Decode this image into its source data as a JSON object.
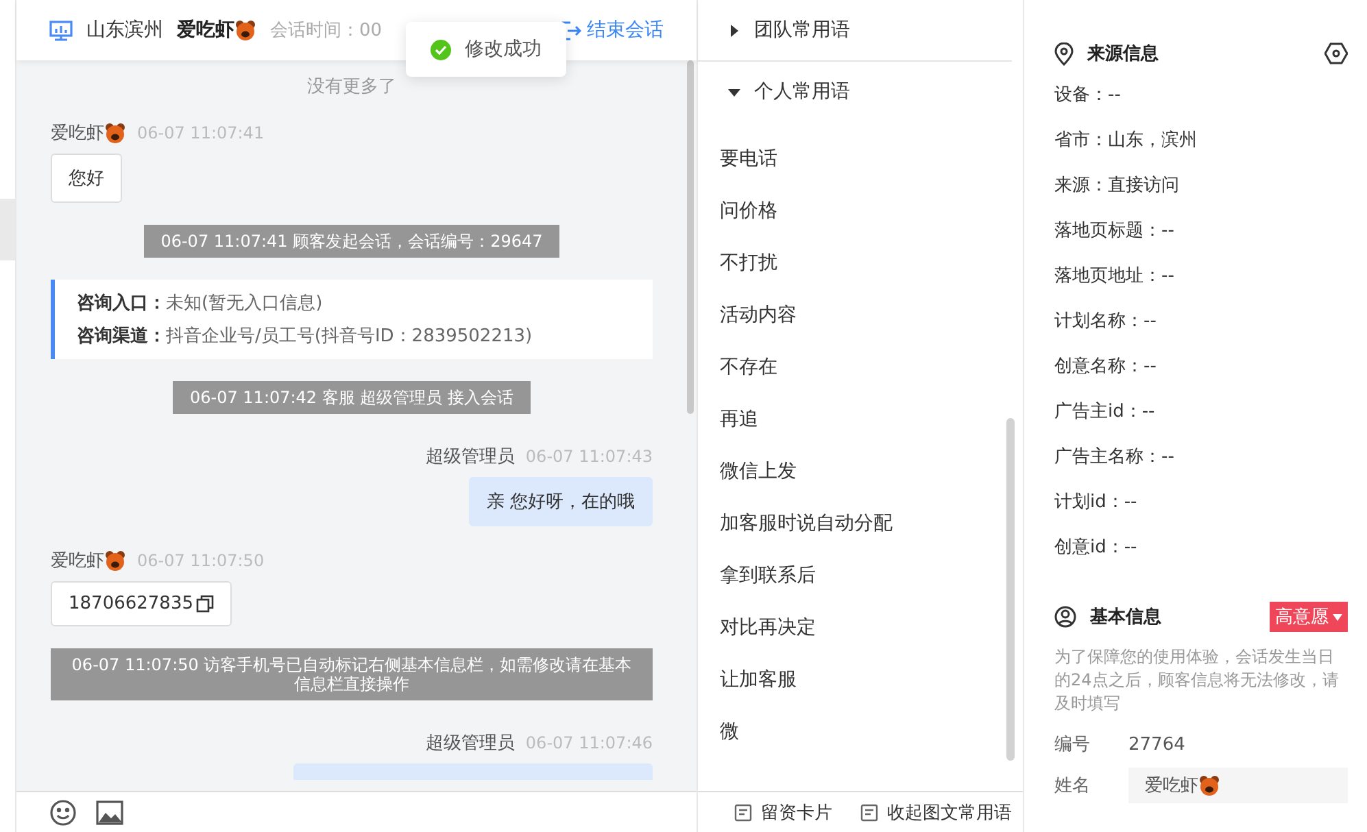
{
  "header": {
    "location": "山东滨州",
    "visitor": "爱吃虾",
    "session_time": "会话时间：00",
    "end_button": "结束会话"
  },
  "toast": {
    "text": "修改成功"
  },
  "messages": [
    {
      "kind": "notice",
      "text": "没有更多了"
    },
    {
      "kind": "visitor",
      "name": "爱吃虾",
      "time": "06-07 11:07:41",
      "text": "您好",
      "copyable": false
    },
    {
      "kind": "system",
      "text": "06-07 11:07:41 顾客发起会话，会话编号：29647"
    },
    {
      "kind": "info",
      "rows": [
        {
          "label": "咨询入口：",
          "value": "未知(暂无入口信息)"
        },
        {
          "label": "咨询渠道：",
          "value": "抖音企业号/员工号(抖音号ID：2839502213)"
        }
      ]
    },
    {
      "kind": "system",
      "text": "06-07 11:07:42 客服 超级管理员 接入会话"
    },
    {
      "kind": "agent",
      "name": "超级管理员",
      "time": "06-07 11:07:43",
      "text": "亲 您好呀，在的哦"
    },
    {
      "kind": "visitor",
      "name": "爱吃虾",
      "time": "06-07 11:07:50",
      "text": "18706627835",
      "copyable": true
    },
    {
      "kind": "system",
      "text": "06-07 11:07:50 访客手机号已自动标记右侧基本信息栏，如需修改请在基本信息栏直接操作"
    },
    {
      "kind": "agent",
      "name": "超级管理员",
      "time": "06-07 11:07:46"
    }
  ],
  "phrases": {
    "groups": [
      {
        "title": "团队常用语",
        "expanded": false
      },
      {
        "title": "个人常用语",
        "expanded": true,
        "items": [
          "要电话",
          "问价格",
          "不打扰",
          "活动内容",
          "不存在",
          "再追",
          "微信上发",
          "加客服时说自动分配",
          "拿到联系后",
          "对比再决定",
          "让加客服",
          "微"
        ]
      }
    ],
    "footer": [
      "留资卡片",
      "收起图文常用语"
    ]
  },
  "source": {
    "title": "来源信息",
    "fields": [
      "设备：--",
      "省市：山东，滨州",
      "来源：直接访问",
      "落地页标题：--",
      "落地页地址：--",
      "计划名称：--",
      "创意名称：--",
      "广告主id：--",
      "广告主名称：--",
      "计划id：--",
      "创意id：--"
    ]
  },
  "basic": {
    "title": "基本信息",
    "tag": "高意愿",
    "note": "为了保障您的使用体验，会话发生当日的24点之后，顾客信息将无法修改，请及时填写",
    "fields": [
      {
        "kind": "text",
        "label": "编号",
        "value": "27764"
      },
      {
        "kind": "input",
        "label": "姓名",
        "value": "爱吃虾"
      }
    ]
  }
}
